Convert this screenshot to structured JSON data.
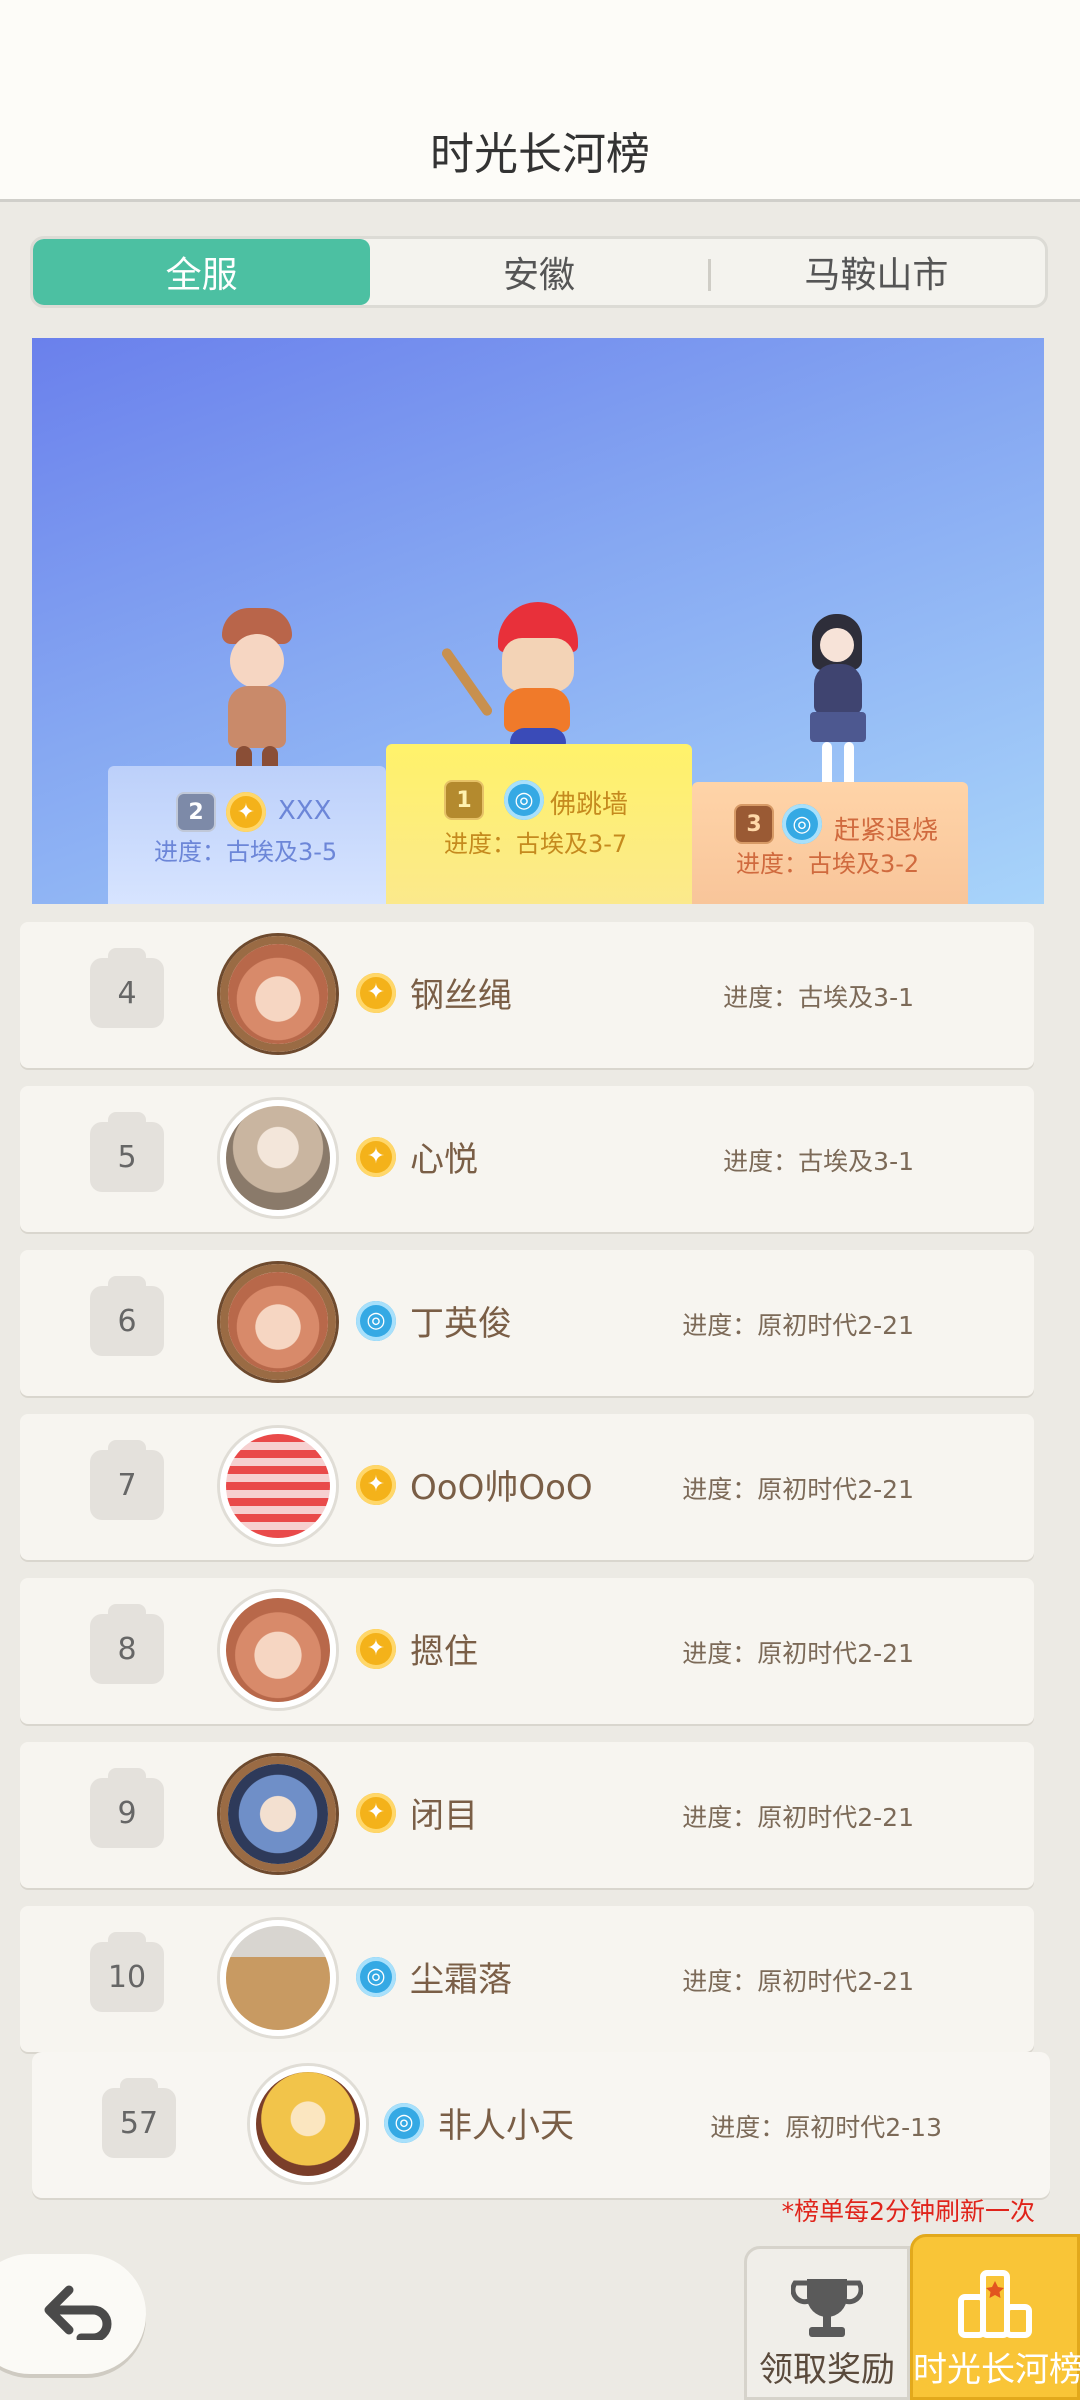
{
  "header": {
    "title": "时光长河榜"
  },
  "tabs": [
    {
      "label": "全服",
      "active": true
    },
    {
      "label": "安徽",
      "active": false
    },
    {
      "label": "马鞍山市",
      "active": false
    }
  ],
  "podium": {
    "second": {
      "rank": "2",
      "name": "XXX",
      "progress": "进度：古埃及3-5",
      "badge": "gold"
    },
    "first": {
      "rank": "1",
      "name": "佛跳墙",
      "progress": "进度：古埃及3-7",
      "badge": "blue"
    },
    "third": {
      "rank": "3",
      "name": "赶紧退烧",
      "progress": "进度：古埃及3-2",
      "badge": "blue"
    }
  },
  "list": [
    {
      "rank": "4",
      "name": "钢丝绳",
      "progress": "进度：古埃及3-1",
      "badge": "gold",
      "avatar": "framed-girl"
    },
    {
      "rank": "5",
      "name": "心悦",
      "progress": "进度：古埃及3-1",
      "badge": "gold",
      "avatar": "angel"
    },
    {
      "rank": "6",
      "name": "丁英俊",
      "progress": "进度：原初时代2-21",
      "badge": "blue",
      "avatar": "framed-girl"
    },
    {
      "rank": "7",
      "name": "OoO帅OoO",
      "progress": "进度：原初时代2-21",
      "badge": "gold",
      "avatar": "gift-bag"
    },
    {
      "rank": "8",
      "name": "摁住",
      "progress": "进度：原初时代2-21",
      "badge": "gold",
      "avatar": "girl"
    },
    {
      "rank": "9",
      "name": "闭目",
      "progress": "进度：原初时代2-21",
      "badge": "gold",
      "avatar": "framed-lady"
    },
    {
      "rank": "10",
      "name": "尘霜落",
      "progress": "进度：原初时代2-21",
      "badge": "blue",
      "avatar": "paper-bag"
    }
  ],
  "me": {
    "rank": "57",
    "name": "非人小天",
    "progress": "进度：原初时代2-13",
    "badge": "blue",
    "avatar": "angel-girl"
  },
  "note": "*榜单每2分钟刷新一次",
  "buttons": {
    "reward": "领取奖励",
    "rank": "时光长河榜"
  },
  "colors": {
    "accent_green": "#4cc0a2",
    "gold": "#f9c537",
    "note_red": "#e0241b"
  },
  "icons": {
    "back": "back-arrow-icon",
    "reward": "trophy-icon",
    "rank": "podium-icon"
  }
}
